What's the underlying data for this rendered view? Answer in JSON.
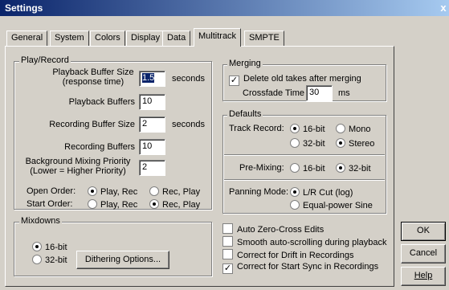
{
  "window": {
    "title": "Settings",
    "close_glyph": "x"
  },
  "tabs": [
    {
      "label": "General"
    },
    {
      "label": "System"
    },
    {
      "label": "Colors"
    },
    {
      "label": "Display"
    },
    {
      "label": "Data"
    },
    {
      "label": "Multitrack",
      "active": true
    },
    {
      "label": "SMPTE"
    }
  ],
  "play_record": {
    "title": "Play/Record",
    "playback_buffer_size": {
      "label_line1": "Playback Buffer Size",
      "label_line2": "(response time)",
      "value": "1.5",
      "unit": "seconds"
    },
    "playback_buffers": {
      "label": "Playback Buffers",
      "value": "10"
    },
    "recording_buffer_size": {
      "label": "Recording Buffer Size",
      "value": "2",
      "unit": "seconds"
    },
    "recording_buffers": {
      "label": "Recording Buffers",
      "value": "10"
    },
    "background_mixing": {
      "label_line1": "Background Mixing Priority",
      "label_line2": "(Lower = Higher Priority)",
      "value": "2"
    },
    "open_order": {
      "label": "Open Order:",
      "options": [
        "Play, Rec",
        "Rec, Play"
      ],
      "selected": "Play, Rec"
    },
    "start_order": {
      "label": "Start Order:",
      "options": [
        "Play, Rec",
        "Rec, Play"
      ],
      "selected": "Rec, Play"
    }
  },
  "mixdowns": {
    "title": "Mixdowns",
    "options": [
      "16-bit",
      "32-bit"
    ],
    "selected": "16-bit",
    "dithering_button": "Dithering Options..."
  },
  "merging": {
    "title": "Merging",
    "delete_old_takes": {
      "label": "Delete old takes after merging",
      "checked": true
    },
    "crossfade_time": {
      "label": "Crossfade Time",
      "value": "30",
      "unit": "ms"
    }
  },
  "defaults": {
    "title": "Defaults",
    "track_record": {
      "label": "Track Record:",
      "bits": [
        "16-bit",
        "32-bit"
      ],
      "bits_selected": "16-bit",
      "channels": [
        "Mono",
        "Stereo"
      ],
      "channels_selected": "Stereo"
    },
    "pre_mixing": {
      "label": "Pre-Mixing:",
      "options": [
        "16-bit",
        "32-bit"
      ],
      "selected": "32-bit"
    },
    "panning_mode": {
      "label": "Panning Mode:",
      "options": [
        "L/R Cut (log)",
        "Equal-power Sine"
      ],
      "selected": "L/R Cut (log)"
    }
  },
  "checkboxes": [
    {
      "label": "Auto Zero-Cross Edits",
      "checked": false
    },
    {
      "label": "Smooth auto-scrolling during playback",
      "checked": false
    },
    {
      "label": "Correct for Drift in Recordings",
      "checked": false
    },
    {
      "label": "Correct for Start Sync in Recordings",
      "checked": true
    }
  ],
  "buttons": {
    "ok": "OK",
    "cancel": "Cancel",
    "help": "Help"
  },
  "glyphs": {
    "check": "✓"
  }
}
